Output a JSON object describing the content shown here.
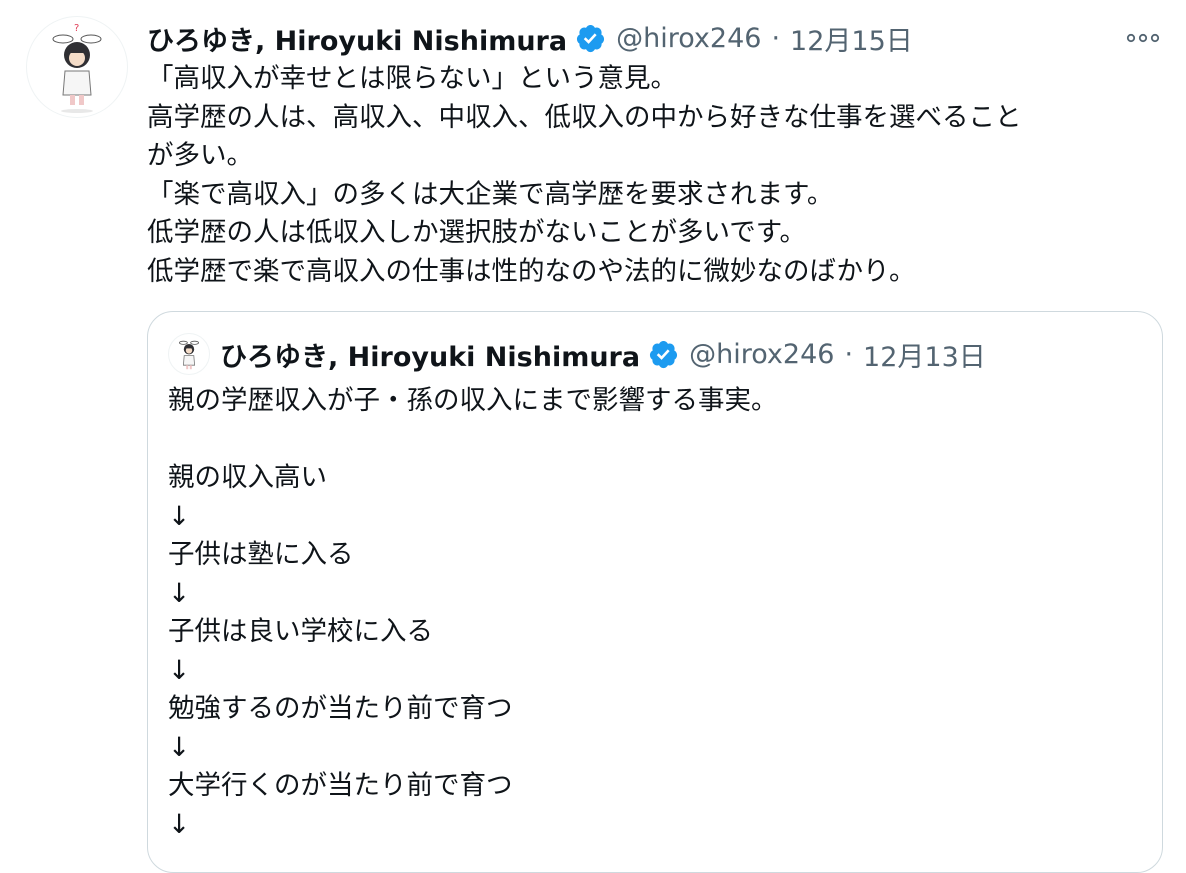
{
  "tweet": {
    "author": {
      "display_name": "ひろゆき, Hiroyuki Nishimura",
      "handle": "@hirox246",
      "verified_icon": "verified-badge-icon"
    },
    "separator": "·",
    "date": "12月15日",
    "more_icon": "more-options-icon",
    "lines": [
      "「高収入が幸せとは限らない」という意見。",
      "高学歴の人は、高収入、中収入、低収入の中から好きな仕事を選べること",
      "が多い。",
      "「楽で高収入」の多くは大企業で高学歴を要求されます。",
      "低学歴の人は低収入しか選択肢がないことが多いです。",
      "低学歴で楽で高収入の仕事は性的なのや法的に微妙なのばかり。"
    ]
  },
  "quoted_tweet": {
    "author": {
      "display_name": "ひろゆき, Hiroyuki Nishimura",
      "handle": "@hirox246",
      "verified_icon": "verified-badge-icon"
    },
    "separator": "·",
    "date": "12月13日",
    "lines": [
      "親の学歴収入が子・孫の収入にまで影響する事実。",
      "",
      "親の収入高い",
      "↓",
      "子供は塾に入る",
      "↓",
      "子供は良い学校に入る",
      "↓",
      "勉強するのが当たり前で育つ",
      "↓",
      "大学行くのが当たり前で育つ",
      "↓"
    ]
  },
  "colors": {
    "text": "#0f1419",
    "secondary": "#536471",
    "verified": "#1d9bf0",
    "border": "#cfd9de"
  }
}
